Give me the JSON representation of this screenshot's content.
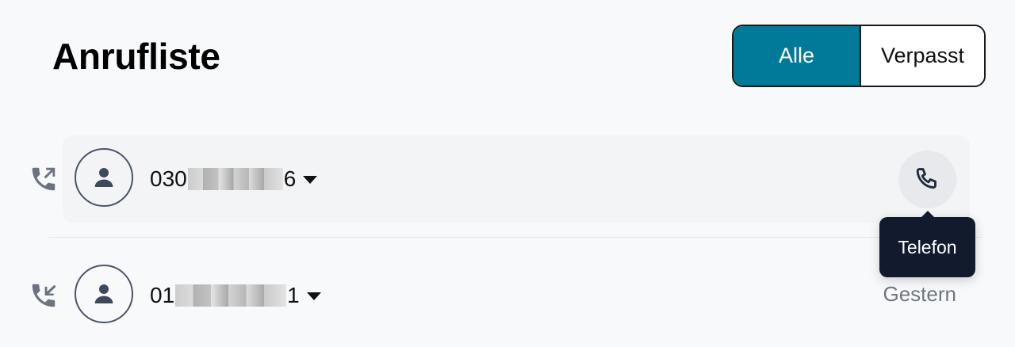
{
  "header": {
    "title": "Anrufliste"
  },
  "filter": {
    "options": [
      {
        "label": "Alle",
        "active": true
      },
      {
        "label": "Verpasst",
        "active": false
      }
    ]
  },
  "calls": [
    {
      "direction_icon": "outgoing-call-icon",
      "avatar_icon": "user-icon",
      "number_prefix": "030",
      "number_suffix": "6",
      "number_redacted": true,
      "action_icon": "phone-icon",
      "tooltip": "Telefon"
    },
    {
      "direction_icon": "incoming-call-icon",
      "avatar_icon": "user-icon",
      "number_prefix": "01",
      "number_suffix": "1",
      "number_redacted": true,
      "timestamp": "Gestern"
    }
  ],
  "colors": {
    "accent": "#017a99",
    "tooltip_bg": "#121b2e",
    "row_highlight": "#f3f4f6",
    "muted_text": "#707780"
  }
}
